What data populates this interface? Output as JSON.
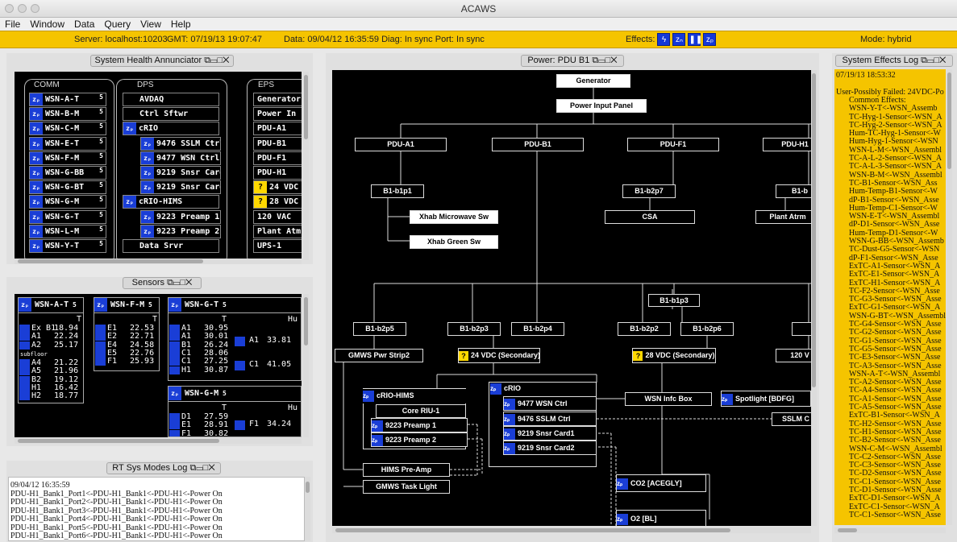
{
  "window": {
    "title": "ACAWS"
  },
  "menu": [
    "File",
    "Window",
    "Data",
    "Query",
    "View",
    "Help"
  ],
  "status": {
    "server": "Server: localhost:10203",
    "gmt": "GMT: 07/19/13 19:07:47",
    "data": "Data: 09/04/12 16:35:59  Diag: In sync  Port: In sync",
    "effects_label": "Effects:",
    "mode": "Mode: hybrid"
  },
  "panels": {
    "health": {
      "title": "System Health Annunciator",
      "groups": [
        "COMM",
        "DPS",
        "EPS"
      ],
      "comm": [
        "WSN-A-T",
        "WSN-B-M",
        "WSN-C-M",
        "WSN-E-T",
        "WSN-F-M",
        "WSN-G-BB",
        "WSN-G-BT",
        "WSN-G-M",
        "WSN-G-T",
        "WSN-L-M",
        "WSN-Y-T"
      ],
      "dps": [
        "AVDAQ",
        "Ctrl Sftwr",
        "cRIO",
        "9476 SSLM Ctrl",
        "9477 WSN Ctrl",
        "9219 Snsr Card1",
        "9219 Snsr Card2",
        "cRIO-HIMS",
        "9223 Preamp 1",
        "9223 Preamp 2",
        "Data Srvr"
      ],
      "eps": [
        "Generator",
        "Power In",
        "PDU-A1",
        "PDU-B1",
        "PDU-F1",
        "PDU-H1",
        "24 VDC",
        "28 VDC",
        "120 VAC",
        "Plant Atm",
        "UPS-1"
      ]
    },
    "sensors": {
      "title": "Sensors",
      "boxes": [
        {
          "name": "WSN-A-T",
          "col": "T",
          "rows": [
            [
              "Ex B1",
              "18.94"
            ],
            [
              "A1",
              "22.24"
            ],
            [
              "A2",
              "25.17"
            ],
            [
              "A4",
              "21.22"
            ],
            [
              "A5",
              "21.96"
            ],
            [
              "B2",
              "19.12"
            ],
            [
              "H1",
              "16.42"
            ],
            [
              "H2",
              "18.77"
            ]
          ]
        },
        {
          "name": "WSN-F-M",
          "col": "T",
          "rows": [
            [
              "E1",
              "22.53"
            ],
            [
              "E2",
              "22.71"
            ],
            [
              "E4",
              "24.58"
            ],
            [
              "E5",
              "22.76"
            ],
            [
              "F1",
              "25.93"
            ]
          ]
        },
        {
          "name": "WSN-G-T",
          "col": "T",
          "col2": "Hu",
          "rows": [
            [
              "A1",
              "30.95"
            ],
            [
              "A1",
              "30.01"
            ],
            [
              "B1",
              "26.24"
            ],
            [
              "C1",
              "28.06"
            ],
            [
              "C1",
              "27.25"
            ],
            [
              "H1",
              "30.87"
            ]
          ],
          "rows2": [
            [
              "A1",
              "33.81"
            ],
            [
              "C1",
              "41.05"
            ]
          ]
        },
        {
          "name": "WSN-G-M",
          "col": "T",
          "col2": "Hu",
          "rows": [
            [
              "D1",
              "27.59"
            ],
            [
              "E1",
              "28.91"
            ],
            [
              "F1",
              "30.82"
            ]
          ],
          "rows2": [
            [
              "F1",
              "34.24"
            ]
          ]
        }
      ],
      "subfloor": "subfloor"
    },
    "rtlog": {
      "title": "RT Sys Modes Log",
      "lines": [
        "09/04/12 16:35:59",
        "PDU-H1_Bank1_Port1<-PDU-H1_Bank1<-PDU-H1<-Power On",
        "PDU-H1_Bank1_Port2<-PDU-H1_Bank1<-PDU-H1<-Power On",
        "PDU-H1_Bank1_Port3<-PDU-H1_Bank1<-PDU-H1<-Power On",
        "PDU-H1_Bank1_Port4<-PDU-H1_Bank1<-PDU-H1<-Power On",
        "PDU-H1_Bank1_Port5<-PDU-H1_Bank1<-PDU-H1<-Power On",
        "PDU-H1_Bank1_Port6<-PDU-H1_Bank1<-PDU-H1<-Power On"
      ]
    },
    "power": {
      "title": "Power: PDU B1",
      "nodes": {
        "generator": "Generator",
        "ppanel": "Power Input Panel",
        "pdua1": "PDU-A1",
        "pdub1": "PDU-B1",
        "pduf1": "PDU-F1",
        "pduh1": "PDU-H1",
        "b1b1p1": "B1-b1p1",
        "b1b2p7": "B1-b2p7",
        "b1b": "B1-b",
        "xmw": "Xhab Microwave Sw",
        "csa": "CSA",
        "plant": "Plant Atrm",
        "xgreen": "Xhab Green Sw",
        "b1b1p3": "B1-b1p3",
        "b1b2p5": "B1-b2p5",
        "b1b2p3": "B1-b2p3",
        "b1b2p4": "B1-b2p4",
        "b1b2p2": "B1-b2p2",
        "b1b2p6": "B1-b2p6",
        "gmwsstrip": "GMWS Pwr Strip2",
        "v24": "24 VDC (Secondary)",
        "v28": "28 VDC (Secondary)",
        "v120": "120 V",
        "criohims": "cRIO-HIMS",
        "coreriu": "Core RIU-1",
        "pre1": "9223 Preamp 1",
        "pre2": "9223 Preamp 2",
        "crio": "cRIO",
        "wsnctrl": "9477 WSN Ctrl",
        "sslmctrl": "9476 SSLM Ctrl",
        "card1": "9219 Snsr Card1",
        "card2": "9219 Snsr Card2",
        "wsnbox": "WSN Infc Box",
        "spot": "Spotlight [BDFG]",
        "sslmc": "SSLM C",
        "himspre": "HIMS Pre-Amp",
        "gmwstask": "GMWS Task Light",
        "co2": "CO2 [ACEGLY]",
        "o2": "O2 [BL]"
      }
    },
    "effects": {
      "title": "System Effects Log",
      "lines": [
        "07/19/13 18:53:32",
        "",
        "User-Possibly Failed: 24VDC-Po",
        "    Common Effects:",
        "WSN-Y-T<-WSN_Assemb",
        "TC-Hyg-1-Sensor<-WSN_A",
        "TC-Hyg-2-Sensor<-WSN_A",
        "Hum-TC-Hyg-1-Sensor<-W",
        "Hum-Hyg-1-Sensor<-WSN",
        "WSN-L-M<-WSN_Assembl",
        "TC-A-L-2-Sensor<-WSN_A",
        "TC-A-L-3-Sensor<-WSN_A",
        "WSN-B-M<-WSN_Assembl",
        "TC-B1-Sensor<-WSN_Ass",
        "Hum-Temp-B1-Sensor<-W",
        "dP-B1-Sensor<-WSN_Asse",
        "Hum-Temp-C1-Sensor<-W",
        "WSN-E-T<-WSN_Assembl",
        "dP-D1-Sensor<-WSN_Asse",
        "Hum-Temp-D1-Sensor<-W",
        "WSN-G-BB<-WSN_Assemb",
        "TC-Dust-G5-Sensor<-WSN",
        "dP-F1-Sensor<-WSN_Asse",
        "ExTC-A1-Sensor<-WSN_A",
        "ExTC-E1-Sensor<-WSN_A",
        "ExTC-H1-Sensor<-WSN_A",
        "TC-F2-Sensor<-WSN_Asse",
        "TC-G3-Sensor<-WSN_Asse",
        "ExTC-G1-Sensor<-WSN_A",
        "WSN-G-BT<-WSN_Assembl",
        "TC-G4-Sensor<-WSN_Asse",
        "TC-G2-Sensor<-WSN_Asse",
        "TC-G1-Sensor<-WSN_Asse",
        "TC-G5-Sensor<-WSN_Asse",
        "TC-E3-Sensor<-WSN_Asse",
        "TC-A3-Sensor<-WSN_Asse",
        "WSN-A-T<-WSN_Assembl",
        "TC-A2-Sensor<-WSN_Asse",
        "TC-A4-Sensor<-WSN_Asse",
        "TC-A1-Sensor<-WSN_Asse",
        "TC-A5-Sensor<-WSN_Asse",
        "ExTC-B1-Sensor<-WSN_A",
        "TC-H2-Sensor<-WSN_Asse",
        "TC-H1-Sensor<-WSN_Asse",
        "TC-B2-Sensor<-WSN_Asse",
        "WSN-C-M<-WSN_Assembl",
        "TC-C2-Sensor<-WSN_Asse",
        "TC-C3-Sensor<-WSN_Asse",
        "TC-D2-Sensor<-WSN_Asse",
        "TC-C1-Sensor<-WSN_Asse",
        "TC-D1-Sensor<-WSN_Asse",
        "ExTC-D1-Sensor<-WSN_A",
        "ExTC-C1-Sensor<-WSN_A",
        "TC-C1-Sensor<-WSN_Asse"
      ]
    }
  },
  "colors": {
    "status_bg": "#f5c400",
    "icon_blue": "#1a3ed6",
    "warn_yellow": "#ffd800",
    "panel_black": "#000000"
  }
}
